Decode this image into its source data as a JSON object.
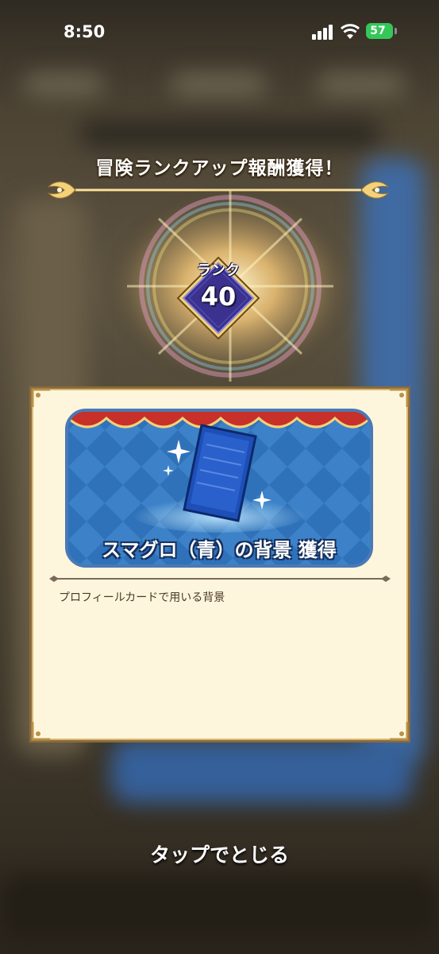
{
  "status_bar": {
    "time": "8:50",
    "battery": "57"
  },
  "headline": "冒険ランクアップ報酬獲得！",
  "rank": {
    "label": "ランク",
    "value": "40"
  },
  "reward": {
    "title": "スマグロ（青）の背景 獲得",
    "description": "プロフィールカードで用いる背景"
  },
  "close_hint": "タップでとじる",
  "colors": {
    "panel": "#fdf6dc",
    "banner": "#2f72b9",
    "badge": "#3b3290",
    "gold": "#f3d27a"
  }
}
